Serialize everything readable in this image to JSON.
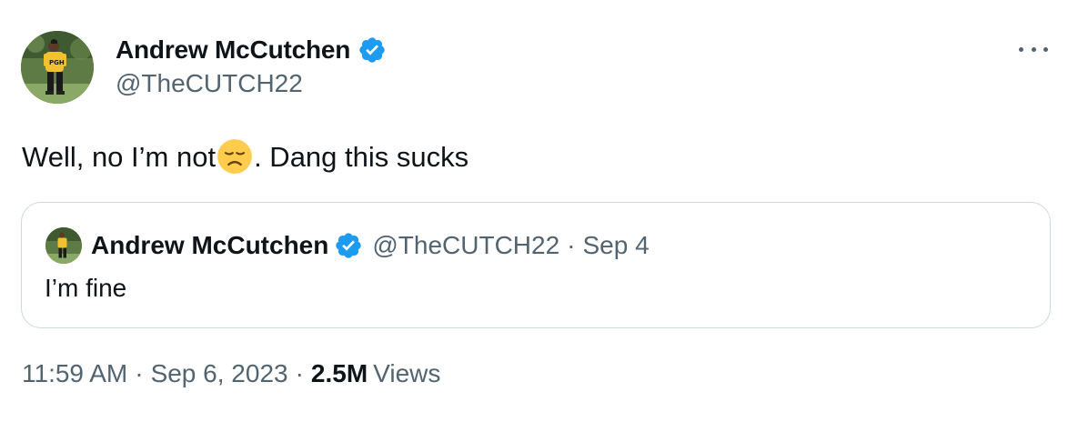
{
  "author": {
    "display_name": "Andrew McCutchen",
    "handle": "@TheCUTCH22",
    "verified_icon": "verified-badge-icon"
  },
  "tweet": {
    "text_before_emoji": "Well, no I’m not",
    "emoji": "disappointed-face",
    "text_after_emoji": ". Dang this sucks"
  },
  "quote": {
    "display_name": "Andrew McCutchen",
    "handle": "@TheCUTCH22",
    "separator": "·",
    "date": "Sep 4",
    "text": "I’m fine"
  },
  "meta": {
    "time": "11:59 AM",
    "separator": "·",
    "date": "Sep 6, 2023",
    "views_count": "2.5M",
    "views_label": "Views"
  },
  "colors": {
    "text_primary": "#0f1419",
    "text_secondary": "#536471",
    "verified_blue": "#1d9bf0",
    "border": "#cfd9de"
  }
}
